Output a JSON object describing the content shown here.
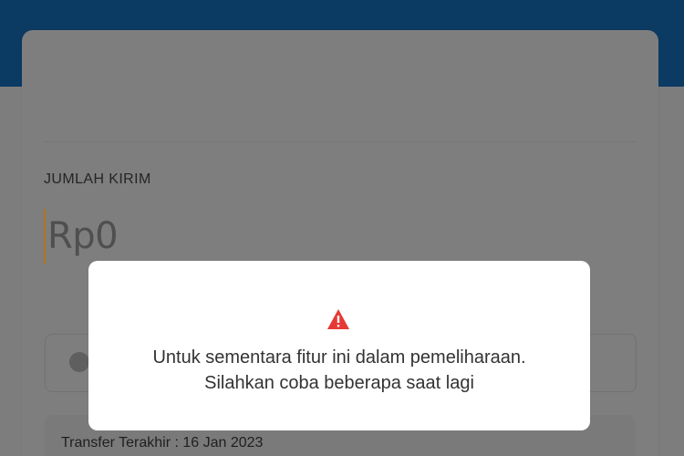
{
  "app": {
    "header_color": "#0b3a63",
    "overlay_color": "#7d7d7d"
  },
  "transfer_form": {
    "amount_label": "JUMLAH KIRIM",
    "amount_placeholder": "Rp0",
    "note_icon": "chat-bubble-icon",
    "last_transfer": "Transfer Terakhir : 16 Jan 2023"
  },
  "maintenance_dialog": {
    "icon": "warning-triangle-icon",
    "icon_color": "#e53935",
    "message_line1": "Untuk sementara fitur ini dalam pemeliharaan.",
    "message_line2": "Silahkan coba beberapa saat lagi"
  }
}
